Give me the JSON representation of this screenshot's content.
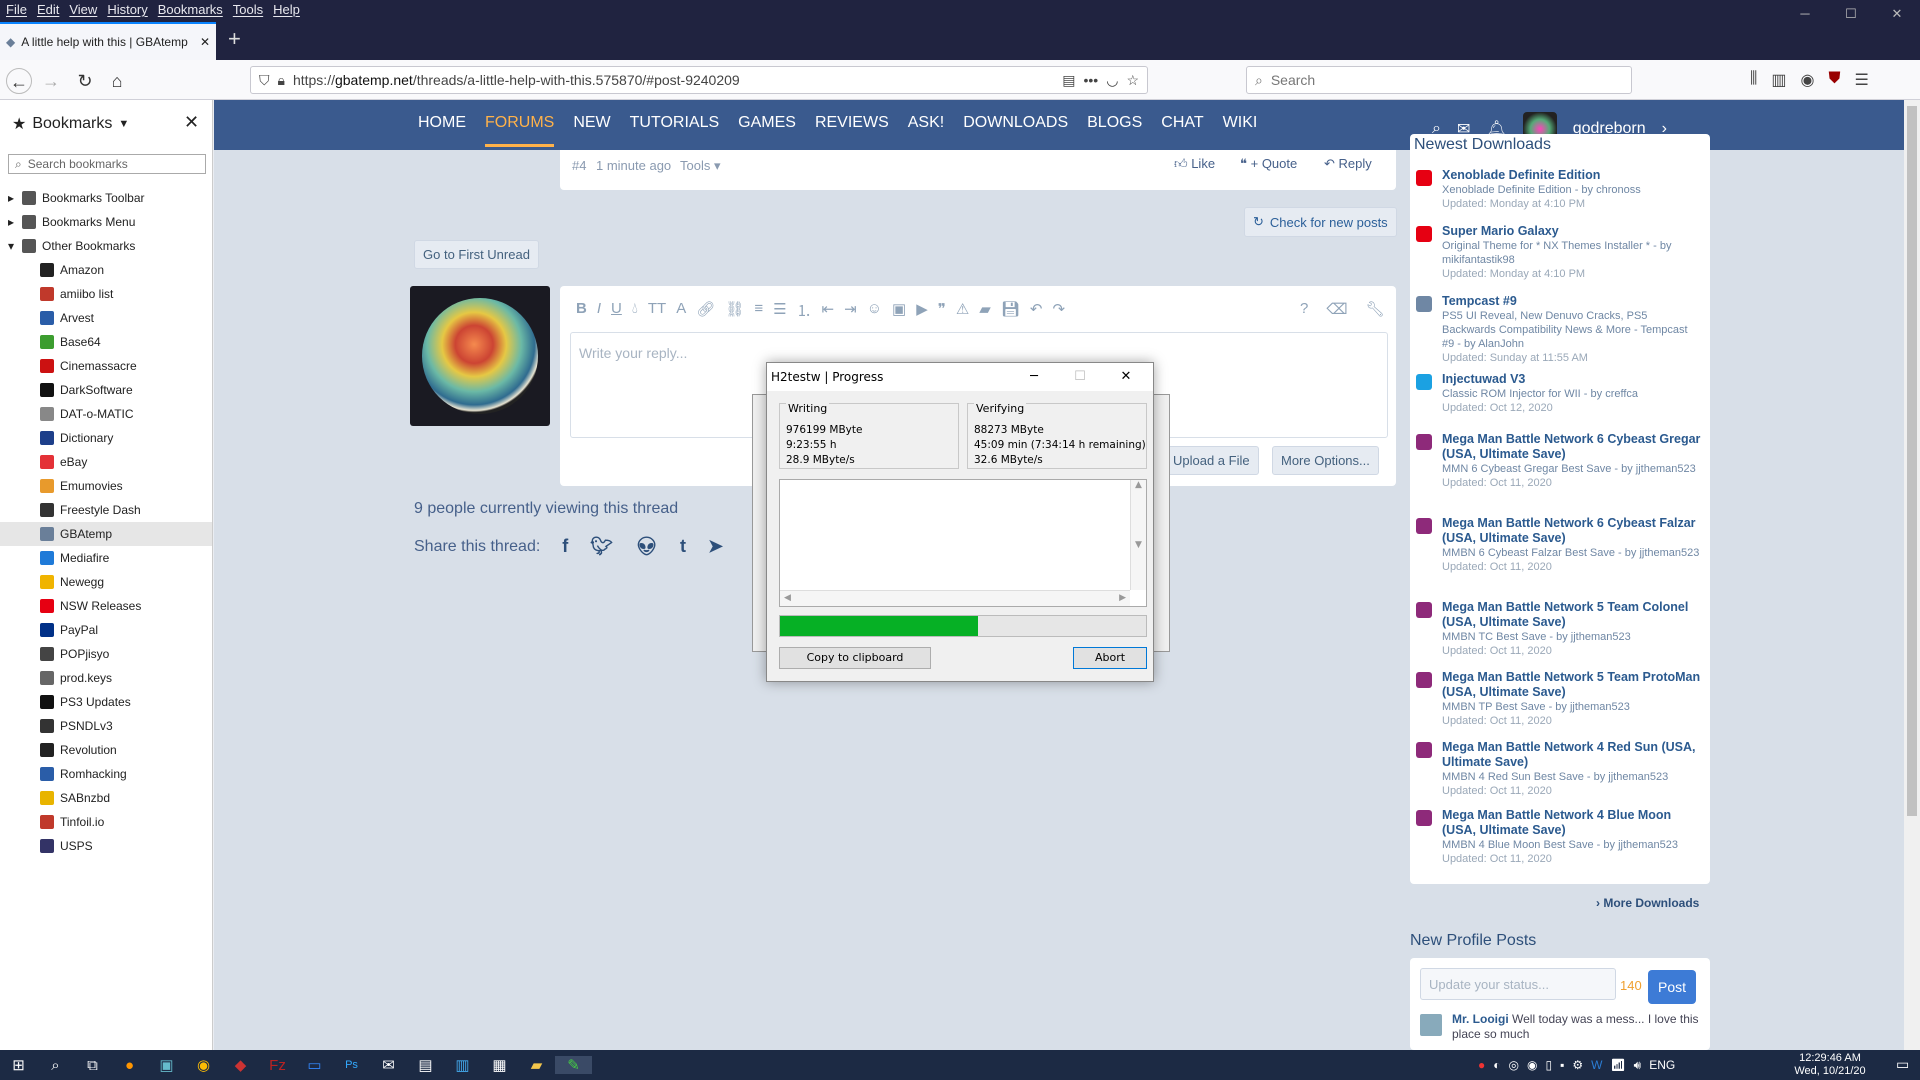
{
  "menu": [
    "File",
    "Edit",
    "View",
    "History",
    "Bookmarks",
    "Tools",
    "Help"
  ],
  "tab": {
    "title": "A little help with this | GBAtemp",
    "close": "✕"
  },
  "url": {
    "prefix": "https://",
    "domain": "gbatemp.net",
    "path": "/threads/a-little-help-with-this.575870/#post-9240209"
  },
  "search": {
    "placeholder": "Search"
  },
  "sidebar": {
    "title": "Bookmarks",
    "search_placeholder": "Search bookmarks",
    "items": [
      {
        "label": "Bookmarks Toolbar",
        "color": "#555"
      },
      {
        "label": "Bookmarks Menu",
        "color": "#555"
      },
      {
        "label": "Other Bookmarks",
        "color": "#555"
      },
      {
        "label": "Amazon",
        "color": "#222"
      },
      {
        "label": "amiibo list",
        "color": "#c0392b"
      },
      {
        "label": "Arvest",
        "color": "#2a5da8"
      },
      {
        "label": "Base64",
        "color": "#3c9d2f"
      },
      {
        "label": "Cinemassacre",
        "color": "#cc1111"
      },
      {
        "label": "DarkSoftware",
        "color": "#111"
      },
      {
        "label": "DAT-o-MATIC",
        "color": "#888"
      },
      {
        "label": "Dictionary",
        "color": "#1d3f8a"
      },
      {
        "label": "eBay",
        "color": "#e43137"
      },
      {
        "label": "Emumovies",
        "color": "#e89a2c"
      },
      {
        "label": "Freestyle Dash",
        "color": "#333"
      },
      {
        "label": "GBAtemp",
        "color": "#6a7f99"
      },
      {
        "label": "Mediafire",
        "color": "#1f7ad8"
      },
      {
        "label": "Newegg",
        "color": "#f0b400"
      },
      {
        "label": "NSW Releases",
        "color": "#e60012"
      },
      {
        "label": "PayPal",
        "color": "#003087"
      },
      {
        "label": "POPjisyo",
        "color": "#444"
      },
      {
        "label": "prod.keys",
        "color": "#666"
      },
      {
        "label": "PS3 Updates",
        "color": "#111"
      },
      {
        "label": "PSNDLv3",
        "color": "#333"
      },
      {
        "label": "Revolution",
        "color": "#222"
      },
      {
        "label": "Romhacking",
        "color": "#2a5da8"
      },
      {
        "label": "SABnzbd",
        "color": "#e8b400"
      },
      {
        "label": "Tinfoil.io",
        "color": "#c0392b"
      },
      {
        "label": "USPS",
        "color": "#333366"
      }
    ]
  },
  "site_nav": [
    "HOME",
    "FORUMS",
    "NEW",
    "TUTORIALS",
    "GAMES",
    "REVIEWS",
    "ASK!",
    "DOWNLOADS",
    "BLOGS",
    "CHAT",
    "WIKI"
  ],
  "user": {
    "name": "godreborn"
  },
  "post_footer": {
    "num": "#4",
    "time": "1 minute ago",
    "tools": "Tools",
    "like": "Like",
    "quote": "+ Quote",
    "reply": "Reply"
  },
  "check_new": "Check for new posts",
  "first_unread": "Go to First Unread",
  "editor": {
    "placeholder": "Write your reply...",
    "upload": "Upload a File",
    "more": "More Options..."
  },
  "viewers": "9 people currently viewing this thread",
  "share_label": "Share this thread:",
  "right": {
    "newest_title": "Newest Downloads",
    "downloads": [
      {
        "t": "Xenoblade Definite Edition",
        "s": "Xenoblade Definite Edition - by chronoss",
        "u": "Updated: Monday at 4:10 PM",
        "c": "#e60012"
      },
      {
        "t": "Super Mario Galaxy",
        "s": "Original Theme for * NX Themes Installer * - by mikifantastik98",
        "u": "Updated: Monday at 4:10 PM",
        "c": "#e60012"
      },
      {
        "t": "Tempcast #9",
        "s": "PS5 UI Reveal, New Denuvo Cracks, PS5 Backwards Compatibility News & More - Tempcast #9 - by AlanJohn",
        "u": "Updated: Sunday at 11:55 AM",
        "c": "#6f87a4"
      },
      {
        "t": "Injectuwad V3",
        "s": "Classic ROM Injector for WII - by creffca",
        "u": "Updated: Oct 12, 2020",
        "c": "#1ba1e2"
      },
      {
        "t": "Mega Man Battle Network 6 Cybeast Gregar (USA, Ultimate Save)",
        "s": "MMN 6 Cybeast Gregar Best Save - by jjtheman523",
        "u": "Updated: Oct 11, 2020",
        "c": "#8e2a7a"
      },
      {
        "t": "Mega Man Battle Network 6 Cybeast Falzar (USA, Ultimate Save)",
        "s": "MMBN 6 Cybeast Falzar Best Save - by jjtheman523",
        "u": "Updated: Oct 11, 2020",
        "c": "#8e2a7a"
      },
      {
        "t": "Mega Man Battle Network 5 Team Colonel (USA, Ultimate Save)",
        "s": "MMBN TC Best Save - by jjtheman523",
        "u": "Updated: Oct 11, 2020",
        "c": "#8e2a7a"
      },
      {
        "t": "Mega Man Battle Network 5 Team ProtoMan (USA, Ultimate Save)",
        "s": "MMBN TP Best Save - by jjtheman523",
        "u": "Updated: Oct 11, 2020",
        "c": "#8e2a7a"
      },
      {
        "t": "Mega Man Battle Network 4 Red Sun (USA, Ultimate Save)",
        "s": "MMBN 4 Red Sun Best Save - by jjtheman523",
        "u": "Updated: Oct 11, 2020",
        "c": "#8e2a7a"
      },
      {
        "t": "Mega Man Battle Network 4 Blue Moon (USA, Ultimate Save)",
        "s": "MMBN 4 Blue Moon Best Save - by jjtheman523",
        "u": "Updated: Oct 11, 2020",
        "c": "#8e2a7a"
      }
    ],
    "more_downloads": "› More Downloads",
    "profile_title": "New Profile Posts",
    "status_placeholder": "Update your status...",
    "count": "140",
    "post_btn": "Post",
    "looigi_name": "Mr. Looigi",
    "looigi_text": "Well today was a mess... I love this place so much"
  },
  "dialog": {
    "title": "H2testw | Progress",
    "writing": {
      "label": "Writing",
      "size": "976199 MByte",
      "time": "9:23:55 h",
      "speed": "28.9 MByte/s"
    },
    "verifying": {
      "label": "Verifying",
      "size": "88273 MByte",
      "time": "45:09 min (7:34:14 h remaining)",
      "speed": "32.6 MByte/s"
    },
    "progress": 0.54,
    "copy_btn": "Copy to clipboard",
    "abort_btn": "Abort"
  },
  "taskbar": {
    "lang": "ENG",
    "time": "12:29:46 AM",
    "date": "Wed, 10/21/20"
  }
}
